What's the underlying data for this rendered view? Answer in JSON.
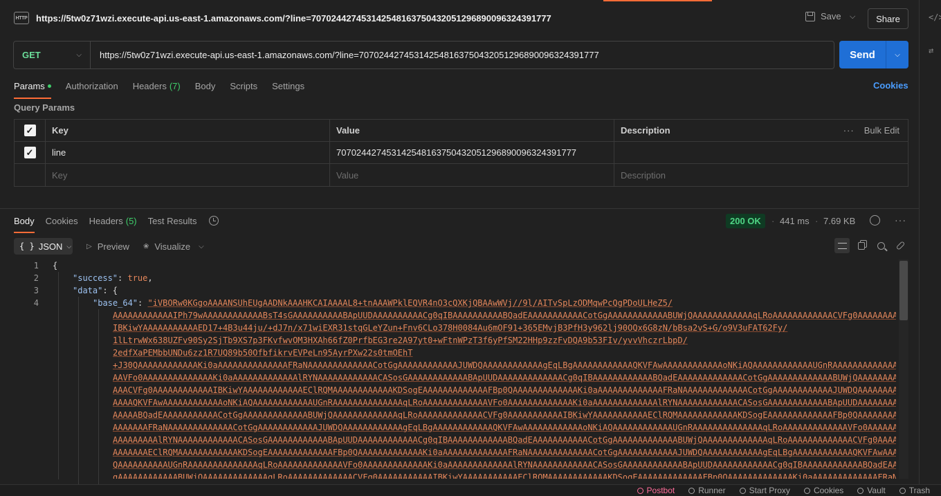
{
  "tab": {
    "icon": "http-icon",
    "title": "https://5tw0z71wzi.execute-api.us-east-1.amazonaws.com/?line=707024427453142548163750432051296890096324391777"
  },
  "header": {
    "save_label": "Save",
    "share_label": "Share"
  },
  "request": {
    "method": "GET",
    "url": "https://5tw0z71wzi.execute-api.us-east-1.amazonaws.com/?line=707024427453142548163750432051296890096324391777",
    "send_label": "Send"
  },
  "request_tabs": {
    "params": "Params",
    "authorization": "Authorization",
    "headers": "Headers",
    "headers_count": "(7)",
    "body": "Body",
    "scripts": "Scripts",
    "settings": "Settings",
    "cookies": "Cookies"
  },
  "query_params": {
    "title": "Query Params",
    "headers": {
      "key": "Key",
      "value": "Value",
      "description": "Description",
      "bulk_edit": "Bulk Edit"
    },
    "rows": [
      {
        "key": "line",
        "value": "707024427453142548163750432051296890096324391777",
        "description": ""
      }
    ],
    "placeholders": {
      "key": "Key",
      "value": "Value",
      "description": "Description"
    }
  },
  "response_tabs": {
    "body": "Body",
    "cookies": "Cookies",
    "headers": "Headers",
    "headers_count": "(5)",
    "test_results": "Test Results"
  },
  "response_meta": {
    "status": "200 OK",
    "time": "441 ms",
    "size": "7.69 KB"
  },
  "format_bar": {
    "json": "JSON",
    "preview": "Preview",
    "visualize": "Visualize"
  },
  "code": {
    "line_numbers": [
      "1",
      "2",
      "3",
      "4"
    ],
    "open_brace": "{",
    "success_key": "\"success\"",
    "success_value": "true",
    "data_key": "\"data\"",
    "base64_key": "\"base_64\"",
    "base64_lines": [
      "\"iVBORw0KGgoAAAANSUhEUgAADNkAAAHKCAIAAAAL8+tnAAAWPklEQVR4nO3cQXKjQBAAwWVj//9l/AITvSpLzODMqwPcQgPDoULHeZ5/",
      "AAAAAAAAAAAAIPh79wAAAAAAAAAAAABsT4sGAAAAAAAAAABApUUDAAAAAAAAAACg0qIBAAAAAAAAAABQadEAAAAAAAAAAACotGgAAAAAAAAAAAABUWjQAAAAAAAAAAAAqLRoAAAAAAAAAAAACVFg0AAAAAAAAAA",
      "IBKiwYAAAAAAAAAAAED17+4B3u44ju/+dJ7n/x71wiEXR31stqGLeYZun+Fnv6CLo378H0084Au6mOF91+365EMvjB3PfH3y962lj90OQx6G8zN/bBsa2vS+G/o9V3uFAT62Fy/",
      "1lLtrwWx638UZFv90Sy2SjTb9XS7p3FKvfwvOM3HXAh66fZ0PrfbEG3re2A97yt0+wFtnWPzT3f6yPfSM22HHp9zzFvDQA9b53FIv/yvvVhczrLbpD/",
      "2edfXaPEMbbUNDu6zz1R7UQ89b50OfbfikrvEVPeLn95AyrPXw22s0tmOEhT",
      "+J30QAAAAAAAAAAAAKi0aAAAAAAAAAAAAAAFRaNAAAAAAAAAAAAACotGgAAAAAAAAAAAAJUWDQAAAAAAAAAAAAgEqLBgAAAAAAAAAAAAQKVFAwAAAAAAAAAAAAoNKiAQAAAAAAAAAAAAUGnRAAAAAAAAAAAAAAqLRoAAAAAAAAAAA",
      "AAVFo0AAAAAAAAAAAAAAKi0aAAAAAAAAAAAAAlRYNAAAAAAAAAAAACASosGAAAAAAAAAAAABApUUDAAAAAAAAAAAAACg0qIBAAAAAAAAAAAABQadEAAAAAAAAAAAAACotGgAAAAAAAAAAAAABUWjQAAAAAAAAAAAAAAqLRoAAAAAAAAA",
      "AAACVFg0AAAAAAAAAAAAIBKiwYAAAAAAAAAAAAEClRQMAAAAAAAAAAAAKDSogEAAAAAAAAAAAAAFBp0QAAAAAAAAAAAAAKi0aAAAAAAAAAAAAAFRaNAAAAAAAAAAAAACotGgAAAAAAAAAAAAJUWDQAAAAAAAAAAAAgEqLBgAAAAAAAAA",
      "AAAAQKVFAwAAAAAAAAAAAAoNKiAQAAAAAAAAAAAAUGnRAAAAAAAAAAAAAAqLRoAAAAAAAAAAAAAVFo0AAAAAAAAAAAAAKi0aAAAAAAAAAAAAAlRYNAAAAAAAAAAAACASosGAAAAAAAAAAAABApUUDAAAAAAAAAAAACg0qIBAAAAAA",
      "AAAAABQadEAAAAAAAAAAACotGgAAAAAAAAAAAAABUWjQAAAAAAAAAAAAAqLRoAAAAAAAAAAAAACVFg0AAAAAAAAAAAIBKiwYAAAAAAAAAAAEClRQMAAAAAAAAAAAAKDSogEAAAAAAAAAAAAAFBp0QAAAAAAAAAAAAAKi0aAAAAAA",
      "AAAAAAAFRaNAAAAAAAAAAAAACotGgAAAAAAAAAAAAJUWDQAAAAAAAAAAAAgEqLBgAAAAAAAAAAAAQKVFAwAAAAAAAAAAAAoNKiAQAAAAAAAAAAAAUGnRAAAAAAAAAAAAAAqLRoAAAAAAAAAAAAAVFo0AAAAAAAAAAAAAKi0aAAAA",
      "AAAAAAAAAlRYNAAAAAAAAAAAACASosGAAAAAAAAAAAABApUUDAAAAAAAAAAAACg0qIBAAAAAAAAAAAABQadEAAAAAAAAAAACotGgAAAAAAAAAAAAABUWjQAAAAAAAAAAAAAqLRoAAAAAAAAAAAAACVFg0AAAAAAAAAAAIBKiwYA",
      "AAAAAAAEClRQMAAAAAAAAAAAAKDSogEAAAAAAAAAAAAAFBp0QAAAAAAAAAAAAAKi0aAAAAAAAAAAAAAFRaNAAAAAAAAAAAAACotGgAAAAAAAAAAAAJUWDQAAAAAAAAAAAAgEqLBgAAAAAAAAAAAAQKVFAwAAAAAAAAAAAAoNKiA",
      "QAAAAAAAAAAUGnRAAAAAAAAAAAAAAqLRoAAAAAAAAAAAAAVFo0AAAAAAAAAAAAAKi0aAAAAAAAAAAAAAlRYNAAAAAAAAAAAACASosGAAAAAAAAAAAABApUUDAAAAAAAAAAAACg0qIBAAAAAAAAAAAABQadEAAAAAAAAAAACotG",
      "gAAAAAAAAAAAABUWjQAAAAAAAAAAAAAqLRoAAAAAAAAAAAAACVFg0AAAAAAAAAAAIBKiwYAAAAAAAAAAAEClRQMAAAAAAAAAAAAKDSogEAAAAAAAAAAAAAFBp0QAAAAAAAAAAAAAKi0aAAAAAAAAAAAAAFRaNAAAAAAAAAAAAACo"
    ]
  },
  "footer": {
    "postbot": "Postbot",
    "runner": "Runner",
    "start_proxy": "Start Proxy",
    "cookies": "Cookies",
    "vault": "Vault",
    "trash": "Trash"
  }
}
